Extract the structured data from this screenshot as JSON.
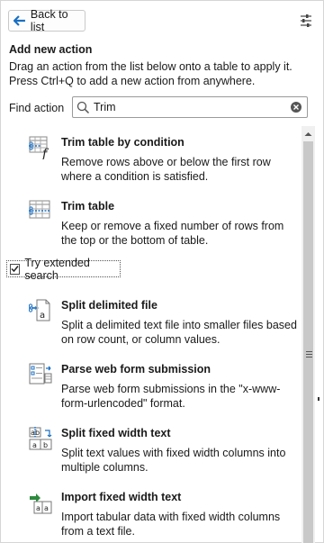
{
  "toolbar": {
    "back_label": "Back to list"
  },
  "panel": {
    "heading": "Add new action",
    "description": "Drag an action from the list below onto a table to apply it. Press Ctrl+Q to add a new action from anywhere."
  },
  "search": {
    "label": "Find action",
    "value": "Trim"
  },
  "results": [
    {
      "title": "Trim table by condition",
      "text": "Remove rows above or below the first row where a condition is satisfied.",
      "icon": "trim-condition-icon"
    },
    {
      "title": "Trim table",
      "text": "Keep or remove a fixed number of rows from the top or the bottom of table.",
      "icon": "trim-table-icon"
    }
  ],
  "extended_search": {
    "label": "Try extended search",
    "checked": true
  },
  "extended_results": [
    {
      "title": "Split delimited file",
      "text": "Split a delimited text file into smaller files based on row count, or column values.",
      "icon": "split-file-icon"
    },
    {
      "title": "Parse web form submission",
      "text": "Parse web form submissions in the \"x-www-form-urlencoded\" format.",
      "icon": "parse-form-icon"
    },
    {
      "title": "Split fixed width text",
      "text": "Split text values with fixed width columns into multiple columns.",
      "icon": "split-fixed-width-icon"
    },
    {
      "title": "Import fixed width text",
      "text": "Import tabular data with fixed width columns from a text file.",
      "icon": "import-fixed-width-icon"
    }
  ],
  "colors": {
    "accent": "#1a6fc4",
    "icon_green": "#2e8b3e"
  }
}
